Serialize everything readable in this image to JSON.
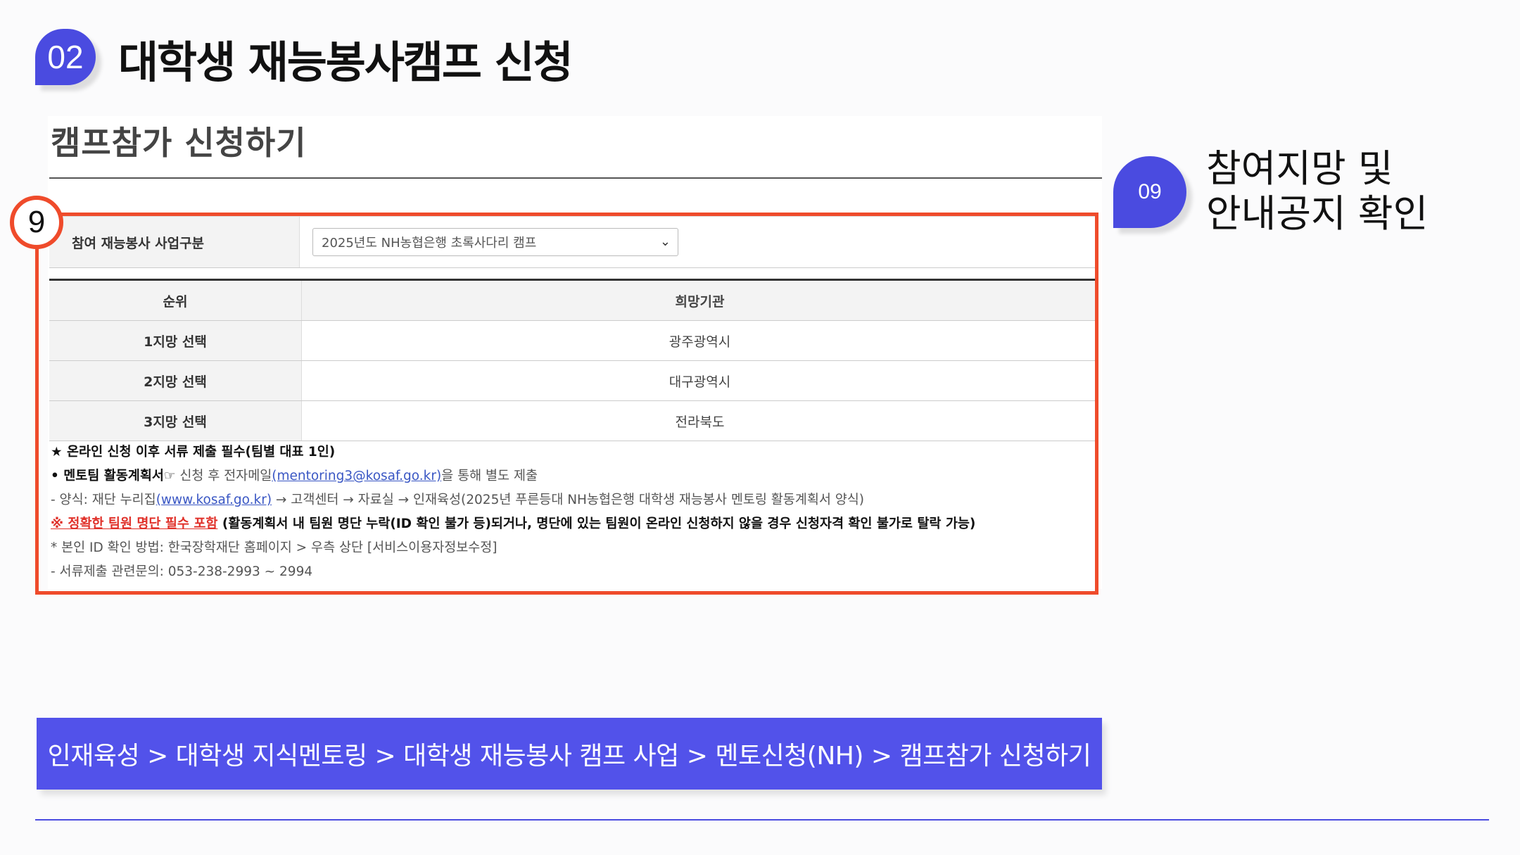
{
  "header": {
    "section_number": "02",
    "title": "대학생 재능봉사캠프 신청"
  },
  "screenshot": {
    "heading": "캠프참가 신청하기",
    "step_number": "9",
    "form": {
      "label": "참여 재능봉사 사업구분",
      "select_value": "2025년도 NH농협은행 초록사다리 캠프"
    },
    "table": {
      "headers": [
        "순위",
        "희망기관"
      ],
      "rows": [
        [
          "1지망 선택",
          "광주광역시"
        ],
        [
          "2지망 선택",
          "대구광역시"
        ],
        [
          "3지망 선택",
          "전라북도"
        ]
      ]
    },
    "notes": {
      "line1": "★ 온라인 신청 이후 서류 제출 필수(팀별 대표 1인)",
      "line2_bold": "• 멘토팀 활동계획서☞",
      "line2_text": " 신청 후 전자메일",
      "line2_link": "(mentoring3@kosaf.go.kr)",
      "line2_tail": "을 통해 별도 제출",
      "line3_pre": "- 양식: 재단 누리집",
      "line3_link": "(www.kosaf.go.kr)",
      "line3_tail": " → 고객센터 → 자료실 → 인재육성(2025년 푸른등대 NH농협은행 대학생 재능봉사 멘토링 활동계획서 양식)",
      "line4_red": "※ 정확한 팀원 명단 필수 포함",
      "line4_text": " (활동계획서 내 팀원 명단 누락(ID 확인 불가 등)되거나, 명단에 있는 팀원이 온라인 신청하지 않을 경우 신청자격 확인 불가로 탈락 가능)",
      "line5": "* 본인 ID 확인 방법: 한국장학재단 홈페이지 > 우측 상단 [서비스이용자정보수정]",
      "line6": "- 서류제출 관련문의: 053-238-2993 ~ 2994"
    }
  },
  "side": {
    "step_number": "09",
    "line1": "참여지망 및",
    "line2": "안내공지 확인"
  },
  "nav_path": "인재육성 > 대학생 지식멘토링 > 대학생 재능봉사 캠프 사업 > 멘토신청(NH) > 캠프참가 신청하기",
  "colors": {
    "accent": "#4a4be0",
    "highlight": "#ef4b2b",
    "nav_bar": "#5252ea"
  }
}
